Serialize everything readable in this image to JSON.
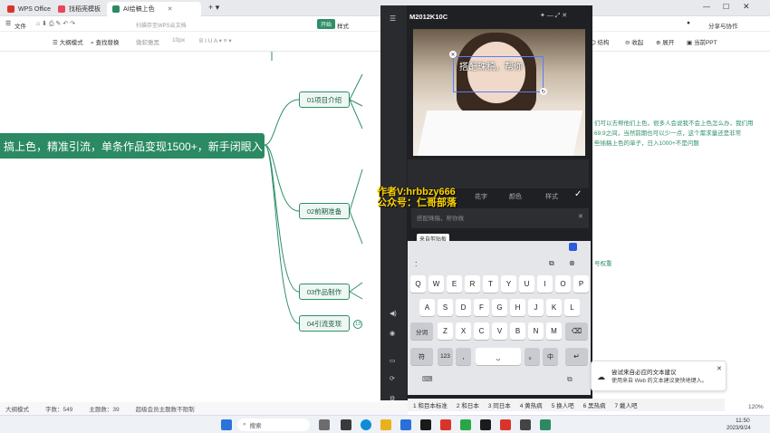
{
  "tabs": [
    {
      "label": "WPS Office",
      "color": "#d9342b"
    },
    {
      "label": "找稻壳模板",
      "color": "#e9465a"
    },
    {
      "label": "AI绘稿上色",
      "color": "#2b8a63"
    }
  ],
  "menu": {
    "file": "文件",
    "doc_title": "扫描存至WPS云文档",
    "badge": "开始",
    "style": "样式",
    "share": "分享与协作"
  },
  "formatbar": {
    "outline_mode": "大纲模式",
    "find_replace": "查找替换",
    "font_dim": "微软雅黑",
    "size_dim": "10px",
    "structure": "结构",
    "collapse": "收起",
    "expand": "展开",
    "export_ppt": "当前PPT"
  },
  "mindmap": {
    "central": "搞上色，精准引流，单条作品变现1500+，新手闭眼入",
    "nodes": [
      "01项目介绍",
      "02前期准备",
      "03作品制作",
      "04引流变现"
    ],
    "right_lines": [
      "们可以去帮他们上色，很多人会说我不会上色怎么办，我们用",
      "69.9之间，当然前期也可以少一点，这个需求量还是非常",
      "些插稿上色的单子，日入1000+不是问题"
    ],
    "badge_count": "13",
    "right_tag": "号权重"
  },
  "phone": {
    "title": "M2012K10C",
    "tools": [
      "花字",
      "颜色",
      "样式"
    ],
    "input_placeholder": "搭配珠稿，帮你做",
    "clipboard_label": "来自剪贴板",
    "colon": ":",
    "row1": [
      "Q",
      "W",
      "E",
      "R",
      "T",
      "Y",
      "U",
      "I",
      "O",
      "P"
    ],
    "row2": [
      "A",
      "S",
      "D",
      "F",
      "G",
      "H",
      "J",
      "K",
      "L"
    ],
    "row3": [
      "分词",
      "Z",
      "X",
      "C",
      "V",
      "B",
      "N",
      "M"
    ],
    "row4": [
      "符",
      "123",
      ",",
      "。",
      "中"
    ],
    "photo_text": "搭配珠稿，帮你"
  },
  "watermark": {
    "line1": "作者V:hrbbzy666",
    "line2": "公众号：仁哥部落"
  },
  "candidates": [
    "1 和目本标准",
    "2 和日本",
    "3 同日本",
    "4 黄热病",
    "5 换人吧",
    "6 黑热病",
    "7 戴人吧"
  ],
  "status": {
    "mode": "大纲模式",
    "chars": "字数：549",
    "topics": "主题数：39",
    "limit": "超级会员主题数不限制",
    "zoom": "120%"
  },
  "notification": {
    "line1": "尝试来自必应的文本建议",
    "line2": "使用来自 Web 的文本建议更快地键入。"
  },
  "taskbar": {
    "search": "搜索",
    "time": "11:50",
    "date": "2023/9/24"
  }
}
